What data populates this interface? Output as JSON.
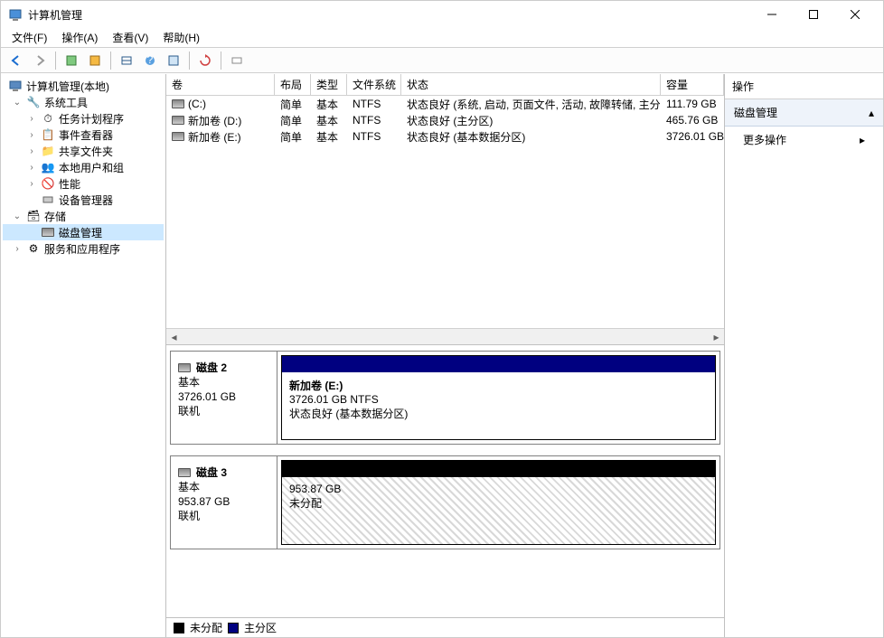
{
  "window": {
    "title": "计算机管理"
  },
  "menu": {
    "file": "文件(F)",
    "action": "操作(A)",
    "view": "查看(V)",
    "help": "帮助(H)"
  },
  "tree": {
    "root": "计算机管理(本地)",
    "systools": "系统工具",
    "scheduler": "任务计划程序",
    "eventvwr": "事件查看器",
    "shares": "共享文件夹",
    "users": "本地用户和组",
    "perf": "性能",
    "devmgr": "设备管理器",
    "storage": "存储",
    "diskmgmt": "磁盘管理",
    "services": "服务和应用程序"
  },
  "columns": {
    "volume": "卷",
    "layout": "布局",
    "type": "类型",
    "fs": "文件系统",
    "status": "状态",
    "capacity": "容量"
  },
  "volumes": [
    {
      "name": "(C:)",
      "layout": "简单",
      "type": "基本",
      "fs": "NTFS",
      "status": "状态良好 (系统, 启动, 页面文件, 活动, 故障转储, 主分区)",
      "capacity": "111.79 GB"
    },
    {
      "name": "新加卷 (D:)",
      "layout": "简单",
      "type": "基本",
      "fs": "NTFS",
      "status": "状态良好 (主分区)",
      "capacity": "465.76 GB"
    },
    {
      "name": "新加卷 (E:)",
      "layout": "简单",
      "type": "基本",
      "fs": "NTFS",
      "status": "状态良好 (基本数据分区)",
      "capacity": "3726.01 GB"
    }
  ],
  "disks": [
    {
      "name": "磁盘 2",
      "type": "基本",
      "size": "3726.01 GB",
      "state": "联机",
      "part": {
        "title": "新加卷 (E:)",
        "line2": "3726.01 GB NTFS",
        "line3": "状态良好 (基本数据分区)",
        "kind": "primary"
      }
    },
    {
      "name": "磁盘 3",
      "type": "基本",
      "size": "953.87 GB",
      "state": "联机",
      "part": {
        "title": "",
        "line2": "953.87 GB",
        "line3": "未分配",
        "kind": "unalloc"
      }
    }
  ],
  "legend": {
    "unalloc": "未分配",
    "primary": "主分区"
  },
  "actions": {
    "header": "操作",
    "section": "磁盘管理",
    "more": "更多操作"
  }
}
